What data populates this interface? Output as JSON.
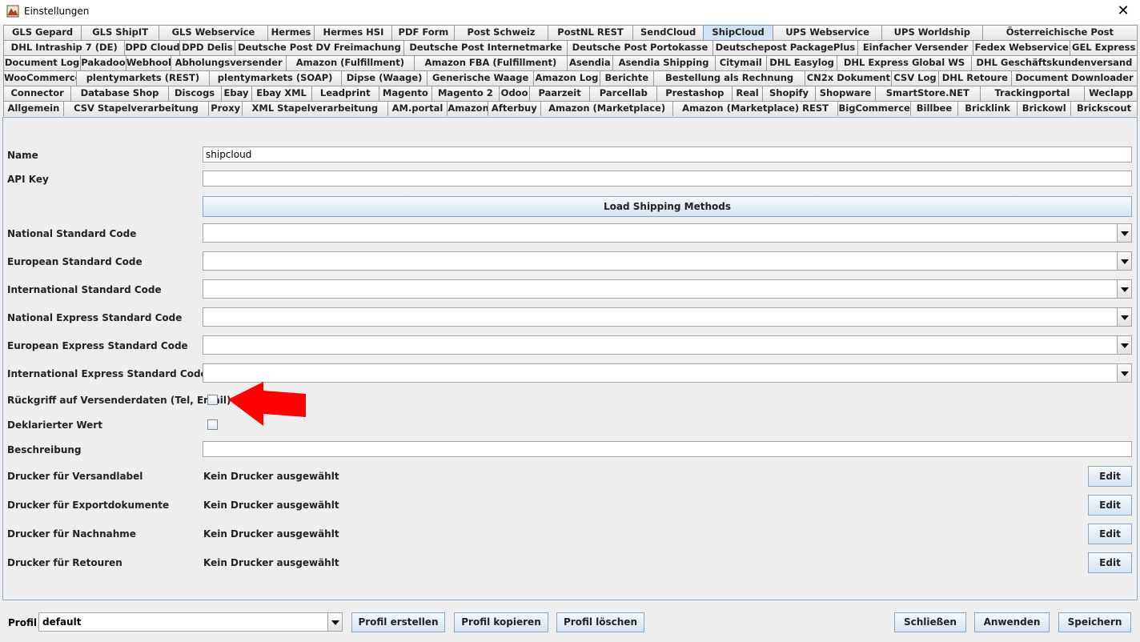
{
  "window": {
    "title": "Einstellungen",
    "close_symbol": "✕"
  },
  "tab_rows": [
    [
      "GLS Gepard",
      "GLS ShipIT",
      "GLS Webservice",
      "Hermes",
      "Hermes HSI",
      "PDF Form",
      "Post Schweiz",
      "PostNL REST",
      "SendCloud",
      "ShipCloud",
      "UPS Webservice",
      "UPS Worldship",
      "Österreichische Post"
    ],
    [
      "DHL Intraship 7 (DE)",
      "DPD Cloud",
      "DPD Delis",
      "Deutsche Post DV Freimachung",
      "Deutsche Post Internetmarke",
      "Deutsche Post Portokasse",
      "Deutschepost PackagePlus",
      "Einfacher Versender",
      "Fedex Webservice",
      "GEL Express"
    ],
    [
      "Document Log",
      "Pakadoo",
      "Webhook",
      "Abholungsversender",
      "Amazon (Fulfillment)",
      "Amazon FBA (Fulfillment)",
      "Asendia",
      "Asendia Shipping",
      "Citymail",
      "DHL Easylog",
      "DHL Express Global WS",
      "DHL Geschäftskundenversand"
    ],
    [
      "WooCommerce",
      "plentymarkets (REST)",
      "plentymarkets (SOAP)",
      "Dipse (Waage)",
      "Generische Waage",
      "Amazon Log",
      "Berichte",
      "Bestellung als Rechnung",
      "CN2x Dokument",
      "CSV Log",
      "DHL Retoure",
      "Document Downloader"
    ],
    [
      "Connector",
      "Database Shop",
      "Discogs",
      "Ebay",
      "Ebay XML",
      "Leadprint",
      "Magento",
      "Magento 2",
      "Odoo",
      "Paarzeit",
      "Parcellab",
      "Prestashop",
      "Real",
      "Shopify",
      "Shopware",
      "SmartStore.NET",
      "Trackingportal",
      "Weclapp"
    ],
    [
      "Allgemein",
      "CSV Stapelverarbeitung",
      "Proxy",
      "XML Stapelverarbeitung",
      "AM.portal",
      "Amazon",
      "Afterbuy",
      "Amazon (Marketplace)",
      "Amazon (Marketplace) REST",
      "BigCommerce",
      "Billbee",
      "Bricklink",
      "Brickowl",
      "Brickscout"
    ]
  ],
  "selected_tab": "ShipCloud",
  "form": {
    "name_label": "Name",
    "name_value": "shipcloud",
    "api_key_label": "API Key",
    "api_key_value": "",
    "load_button": "Load Shipping Methods",
    "national_standard_label": "National Standard Code",
    "european_standard_label": "European Standard Code",
    "international_standard_label": "International Standard Code",
    "national_express_label": "National Express Standard Code",
    "european_express_label": "European Express Standard Code",
    "international_express_label": "International Express Standard Code",
    "fallback_label": "Rückgriff auf Versenderdaten (Tel, Email)",
    "fallback_checked": false,
    "declared_value_label": "Deklarierter Wert",
    "declared_value_checked": false,
    "description_label": "Beschreibung",
    "description_value": "",
    "printers": [
      {
        "label": "Drucker für Versandlabel",
        "value": "Kein Drucker ausgewählt",
        "button": "Edit"
      },
      {
        "label": "Drucker für Exportdokumente",
        "value": "Kein Drucker ausgewählt",
        "button": "Edit"
      },
      {
        "label": "Drucker für Nachnahme",
        "value": "Kein Drucker ausgewählt",
        "button": "Edit"
      },
      {
        "label": "Drucker für Retouren",
        "value": "Kein Drucker ausgewählt",
        "button": "Edit"
      }
    ]
  },
  "annotation": {
    "arrow_color": "#ff0000"
  },
  "footer": {
    "profil_label": "Profil",
    "profil_value": "default",
    "create_profile": "Profil erstellen",
    "copy_profile": "Profil kopieren",
    "delete_profile": "Profil löschen",
    "close": "Schließen",
    "apply": "Anwenden",
    "save": "Speichern"
  },
  "colors": {
    "selected_tab": "#d3e3f5",
    "panel_border": "#8aa6c5",
    "background": "#eeeeee"
  }
}
